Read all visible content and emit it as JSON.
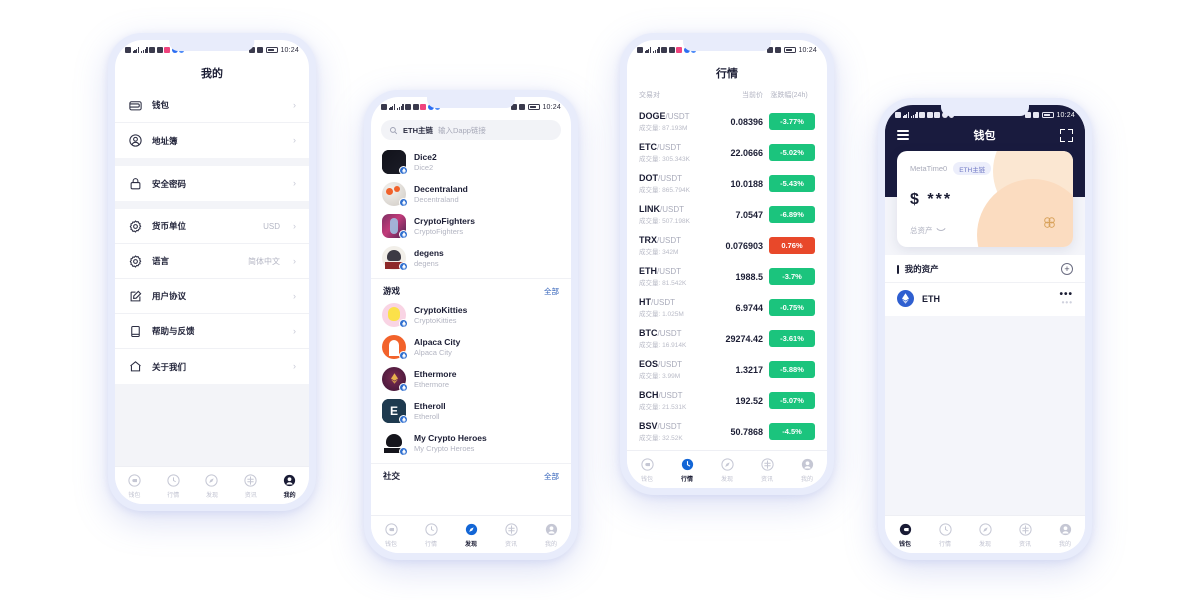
{
  "status_bar": {
    "time": "10:24",
    "dots": "···"
  },
  "phone_mine": {
    "title": "我的",
    "groups": [
      {
        "items": [
          {
            "icon": "wallet-icon",
            "label": "钱包",
            "value": ""
          },
          {
            "icon": "address-book-icon",
            "label": "地址簿",
            "value": ""
          }
        ]
      },
      {
        "items": [
          {
            "icon": "lock-icon",
            "label": "安全密码",
            "value": ""
          }
        ]
      },
      {
        "items": [
          {
            "icon": "gear-icon",
            "label": "货币单位",
            "value": "USD"
          },
          {
            "icon": "gear-icon",
            "label": "语言",
            "value": "简体中文"
          },
          {
            "icon": "edit-icon",
            "label": "用户协议",
            "value": ""
          },
          {
            "icon": "book-icon",
            "label": "帮助与反馈",
            "value": ""
          },
          {
            "icon": "home-icon",
            "label": "关于我们",
            "value": ""
          }
        ]
      }
    ],
    "tabs": [
      {
        "label": "钱包",
        "icon": "wallet-tab-icon",
        "active": false
      },
      {
        "label": "行情",
        "icon": "market-tab-icon",
        "active": false
      },
      {
        "label": "发现",
        "icon": "compass-tab-icon",
        "active": false
      },
      {
        "label": "资讯",
        "icon": "news-tab-icon",
        "active": false
      },
      {
        "label": "我的",
        "icon": "profile-tab-icon",
        "active": true
      }
    ]
  },
  "phone_discover": {
    "search": {
      "chain": "ETH主链",
      "placeholder": "输入Dapp链接"
    },
    "top_apps": [
      {
        "name": "Dice2",
        "sub": "Dice2"
      },
      {
        "name": "Decentraland",
        "sub": "Decentraland"
      },
      {
        "name": "CryptoFighters",
        "sub": "CryptoFighters"
      },
      {
        "name": "degens",
        "sub": "degens"
      }
    ],
    "section": {
      "title": "游戏",
      "more": "全部"
    },
    "games": [
      {
        "name": "CryptoKitties",
        "sub": "CryptoKitties"
      },
      {
        "name": "Alpaca City",
        "sub": "Alpaca City"
      },
      {
        "name": "Ethermore",
        "sub": "Ethermore"
      },
      {
        "name": "Etheroll",
        "sub": "Etheroll"
      },
      {
        "name": "My Crypto Heroes",
        "sub": "My Crypto Heroes"
      }
    ],
    "section2": {
      "title": "社交",
      "more": "全部"
    },
    "tabs": [
      {
        "label": "钱包",
        "active": false
      },
      {
        "label": "行情",
        "active": false
      },
      {
        "label": "发现",
        "active": true
      },
      {
        "label": "资讯",
        "active": false
      },
      {
        "label": "我的",
        "active": false
      }
    ]
  },
  "phone_market": {
    "title": "行情",
    "headers": {
      "pair": "交易对",
      "price": "当前价",
      "change": "涨跌幅(24h)"
    },
    "vol_label": "成交量:",
    "colors": {
      "down": "#1bc47d",
      "up": "#e8482a"
    },
    "rows": [
      {
        "base": "DOGE",
        "quote": "/USDT",
        "volume": "87.193M",
        "price": "0.08396",
        "change": "-3.77%",
        "dir": "down"
      },
      {
        "base": "ETC",
        "quote": "/USDT",
        "volume": "305.343K",
        "price": "22.0666",
        "change": "-5.02%",
        "dir": "down"
      },
      {
        "base": "DOT",
        "quote": "/USDT",
        "volume": "865.794K",
        "price": "10.0188",
        "change": "-5.43%",
        "dir": "down"
      },
      {
        "base": "LINK",
        "quote": "/USDT",
        "volume": "507.198K",
        "price": "7.0547",
        "change": "-6.89%",
        "dir": "down"
      },
      {
        "base": "TRX",
        "quote": "/USDT",
        "volume": "342M",
        "price": "0.076903",
        "change": "0.76%",
        "dir": "up"
      },
      {
        "base": "ETH",
        "quote": "/USDT",
        "volume": "81.542K",
        "price": "1988.5",
        "change": "-3.7%",
        "dir": "down"
      },
      {
        "base": "HT",
        "quote": "/USDT",
        "volume": "1.025M",
        "price": "6.9744",
        "change": "-0.75%",
        "dir": "down"
      },
      {
        "base": "BTC",
        "quote": "/USDT",
        "volume": "16.914K",
        "price": "29274.42",
        "change": "-3.61%",
        "dir": "down"
      },
      {
        "base": "EOS",
        "quote": "/USDT",
        "volume": "3.99M",
        "price": "1.3217",
        "change": "-5.88%",
        "dir": "down"
      },
      {
        "base": "BCH",
        "quote": "/USDT",
        "volume": "21.531K",
        "price": "192.52",
        "change": "-5.07%",
        "dir": "down"
      },
      {
        "base": "BSV",
        "quote": "/USDT",
        "volume": "32.52K",
        "price": "50.7868",
        "change": "-4.5%",
        "dir": "down"
      }
    ],
    "tabs": [
      {
        "label": "钱包",
        "active": false
      },
      {
        "label": "行情",
        "active": true
      },
      {
        "label": "发现",
        "active": false
      },
      {
        "label": "资讯",
        "active": false
      },
      {
        "label": "我的",
        "active": false
      }
    ]
  },
  "phone_wallet": {
    "title": "钱包",
    "card": {
      "account": "MetaTime0",
      "chain_chip": "ETH主链",
      "currency_symbol": "$",
      "amount": "***",
      "total_label": "总资产"
    },
    "assets_section": {
      "title": "我的资产",
      "add": "+"
    },
    "assets": [
      {
        "symbol": "ETH",
        "menu": "•••"
      }
    ],
    "tabs": [
      {
        "label": "钱包",
        "active": true
      },
      {
        "label": "行情",
        "active": false
      },
      {
        "label": "发现",
        "active": false
      },
      {
        "label": "资讯",
        "active": false
      },
      {
        "label": "我的",
        "active": false
      }
    ]
  }
}
